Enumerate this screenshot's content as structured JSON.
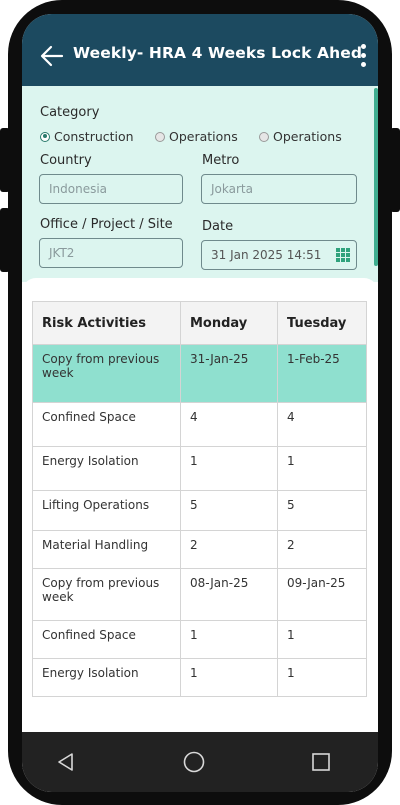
{
  "app_bar": {
    "title": "Weekly- HRA 4 Weeks Lock Ahed"
  },
  "form": {
    "category_label": "Category",
    "category_options": [
      {
        "label": "Construction",
        "selected": true
      },
      {
        "label": "Operations",
        "selected": false
      },
      {
        "label": "Operations",
        "selected": false
      }
    ],
    "country_label": "Country",
    "country_value": "Indonesia",
    "metro_label": "Metro",
    "metro_value": "Jokarta",
    "office_label": "Office / Project / Site",
    "office_value": "JKT2",
    "date_label": "Date",
    "date_value": "31 Jan 2025 14:51"
  },
  "table": {
    "headers": [
      "Risk Activities",
      "Monday",
      "Tuesday"
    ],
    "rows": [
      [
        "Copy from previous week",
        "31-Jan-25",
        "1-Feb-25"
      ],
      [
        "Confined Space",
        "4",
        "4"
      ],
      [
        "Energy Isolation",
        "1",
        "1"
      ],
      [
        "Lifting Operations",
        "5",
        "5"
      ],
      [
        "Material Handling",
        "2",
        "2"
      ],
      [
        "Copy from previous week",
        "08-Jan-25",
        "09-Jan-25"
      ],
      [
        "Confined Space",
        "1",
        "1"
      ],
      [
        "Energy Isolation",
        "1",
        "1"
      ]
    ]
  },
  "colors": {
    "app_bar": "#1c4a60",
    "form_bg": "#dcf5ef",
    "highlight_row": "#8fe0cf",
    "accent": "#2fa27c"
  },
  "icons": [
    "arrow-left-icon",
    "more-vert-icon",
    "calendar-grid-icon",
    "nav-back-icon",
    "nav-home-icon",
    "nav-recents-icon"
  ]
}
